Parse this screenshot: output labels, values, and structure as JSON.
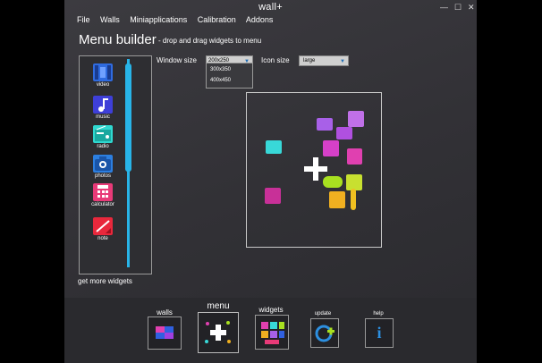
{
  "window": {
    "title": "wall+",
    "controls": [
      "—",
      "☐",
      "✕"
    ]
  },
  "menubar": [
    "File",
    "Walls",
    "Miniapplications",
    "Calibration",
    "Addons"
  ],
  "header": {
    "title": "Menu builder",
    "subtitle": "- drop and drag widgets to menu"
  },
  "sidebar": {
    "items": [
      {
        "label": "video",
        "icon": "film-icon",
        "color": "#2f6be0"
      },
      {
        "label": "music",
        "icon": "music-note-icon",
        "color": "#3e3fd8"
      },
      {
        "label": "radio",
        "icon": "radio-icon",
        "color": "#2fd8d0"
      },
      {
        "label": "photos",
        "icon": "camera-icon",
        "color": "#2c7fe0"
      },
      {
        "label": "calculator",
        "icon": "calculator-icon",
        "color": "#e83a78"
      },
      {
        "label": "note",
        "icon": "note-icon",
        "color": "#e8283c"
      }
    ],
    "more_link": "get more widgets"
  },
  "controls": {
    "window_size_label": "Window size",
    "window_size_value": "200x250",
    "window_size_options": [
      "300x350",
      "400x450"
    ],
    "icon_size_label": "Icon size",
    "icon_size_value": "large"
  },
  "canvas_widgets": [
    {
      "icon": "radio-icon",
      "color": "#38d8d8"
    },
    {
      "icon": "chat-icon",
      "color": "#a860e8"
    },
    {
      "icon": "rss-icon",
      "color": "#c070e8"
    },
    {
      "icon": "mail-icon",
      "color": "#b050e0"
    },
    {
      "icon": "twitter-icon",
      "color": "#d640c8"
    },
    {
      "icon": "facebook-icon",
      "color": "#e040b0"
    },
    {
      "icon": "plus-icon",
      "color": "#ffffff"
    },
    {
      "icon": "weather-icon",
      "color": "#a8e020"
    },
    {
      "icon": "calendar-icon",
      "color": "#c8e030"
    },
    {
      "icon": "dollar-icon",
      "color": "#c83098"
    },
    {
      "icon": "dice-icon",
      "color": "#f0b020"
    },
    {
      "icon": "thermometer-icon",
      "color": "#f0c020"
    }
  ],
  "dock": {
    "items": [
      {
        "label": "walls",
        "icon": "walls-icon"
      },
      {
        "label": "menu",
        "icon": "menu-icon"
      },
      {
        "label": "widgets",
        "icon": "widgets-icon"
      },
      {
        "label": "update",
        "icon": "update-icon"
      },
      {
        "label": "help",
        "icon": "help-icon",
        "glyph": "i"
      }
    ]
  },
  "colors": {
    "accent": "#28b4e8",
    "background": "#333237"
  }
}
